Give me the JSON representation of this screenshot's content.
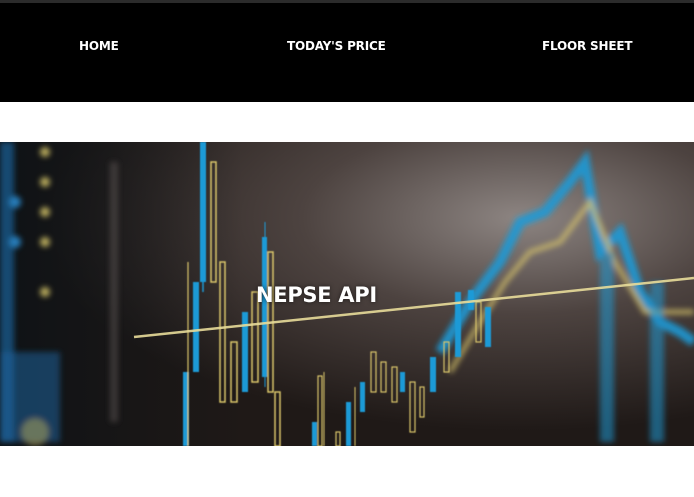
{
  "nav": {
    "items": [
      {
        "label": "HOME"
      },
      {
        "label": "TODAY'S PRICE"
      },
      {
        "label": "FLOOR SHEET"
      }
    ]
  },
  "hero": {
    "title": "NEPSE API",
    "image": "stock-chart-background"
  },
  "colors": {
    "navbar": "#000000",
    "nav_text": "#ffffff",
    "chart_blue": "#1e9ad6",
    "chart_yellow": "#d9c56a"
  }
}
